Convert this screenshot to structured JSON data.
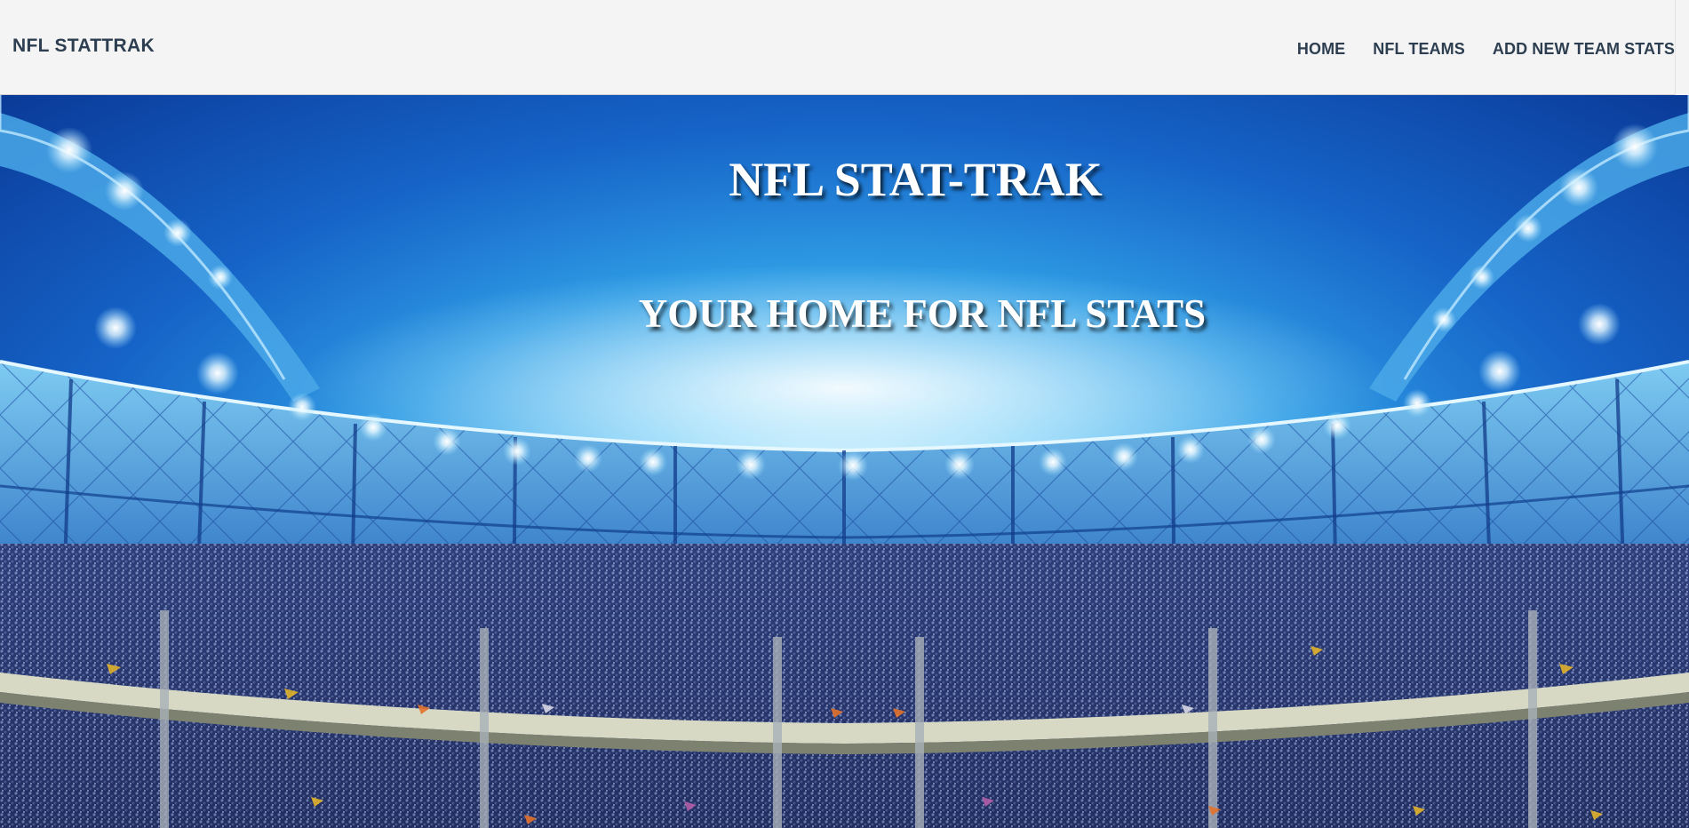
{
  "nav": {
    "brand": "NFL STATTRAK",
    "links": [
      {
        "label": "HOME"
      },
      {
        "label": "NFL TEAMS"
      },
      {
        "label": "ADD NEW TEAM STATS"
      }
    ]
  },
  "hero": {
    "title": "NFL STAT-TRAK",
    "subtitle": "YOUR HOME FOR NFL STATS",
    "background": "stadium-under-lights"
  },
  "colors": {
    "nav_bg": "#f4f4f4",
    "nav_text": "#2c3e50",
    "sky": "#2e9be4"
  }
}
